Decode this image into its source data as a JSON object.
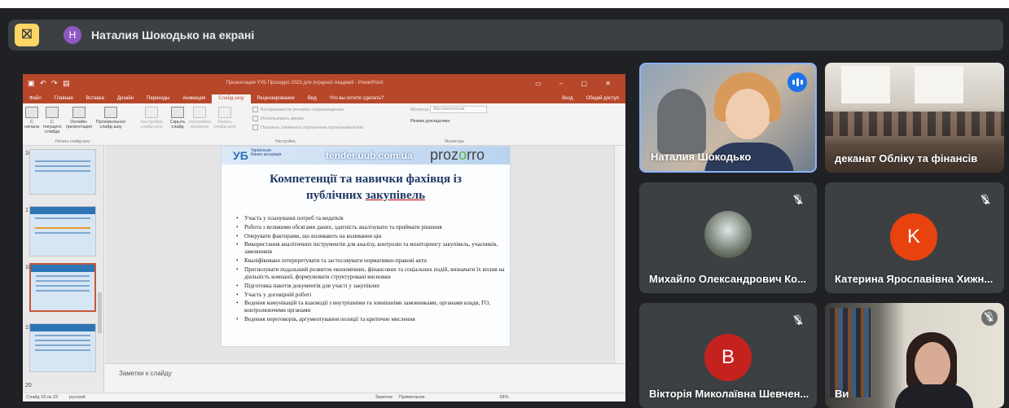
{
  "presentation_bar": {
    "icon": "stop-presenting-icon",
    "avatar_letter": "Н",
    "text": "Наталия Шокодько на екрані"
  },
  "ppt": {
    "title": "Презентация УУБ Прозорро 2023 для Аграрної Академії - PowerPoint",
    "tabs": [
      "Файл",
      "Главная",
      "Вставка",
      "Дизайн",
      "Переходы",
      "Анимация",
      "Слайд-шоу",
      "Рецензирование",
      "Вид",
      "Что вы хотите сделать?"
    ],
    "active_tab": "Слайд-шоу",
    "account": "Вход",
    "share": "Общий доступ",
    "ribbon": {
      "btn1": "С начала",
      "btn2": "С текущего слайда",
      "btn3": "Онлайн-презентация",
      "btn4": "Произвольное слайд-шоу",
      "btn5": "Настройка слайд-шоу",
      "btn6": "Скрыть слайд",
      "btn7": "Настройка времени",
      "btn8": "Запись слайд-шоу",
      "chk1": "Воспроизвести речевое сопровождение",
      "chk2": "Использовать время",
      "chk3": "Показать элементы управления проигрывателем",
      "monitor_label": "Монитор:",
      "monitor_value": "Автоматически",
      "presenter_mode": "Режим докладчика",
      "group1": "Начать слайд-шоу",
      "group2": "Настройка",
      "group3": "Мониторы"
    },
    "thumb_numbers": [
      "16",
      "17",
      "18",
      "19",
      "20"
    ],
    "slide": {
      "logo_text": "Українська бізнес-асоціація",
      "site": "tender.uub.com.ua",
      "prozorro_a": "proz",
      "prozorro_b": "o",
      "prozorro_c": "rro",
      "title_line1": "Компетенції та навички фахівця із",
      "title_line2_a": "публічних ",
      "title_line2_b": "закупівель",
      "bullets": [
        "Участь у плануванні потреб та видатків",
        "Робота з великими обсягами даних, здатність аналізувати та приймати рішення",
        "Оперувати факторами, що впливають на коливання цін",
        "Використання аналітичних інструментів для аналізу, контролю та моніторингу закупівель, учасників, замовників",
        "Кваліфіковано інтерпретувати та застосовувати нормативно-правові акти",
        "Прогнозувати подальший розвиток економічних, фінансових та соціальних подій, визначати їх вплив на діяльність компанії, формулювати структуровані висновки",
        "Підготовка пакетів документів для участі у закупівлях",
        "Участь у договірній роботі",
        "Ведення комунікацій та взаємодії з внутрішніми та зовнішніми замовниками, органами влади, ГО, контролюючими органами",
        "Ведення переговорів, аргументування позиції та критичне мислення"
      ]
    },
    "notes_placeholder": "Заметки к слайду",
    "status": {
      "slide_of": "Слайд 18 из 23",
      "language": "русский",
      "notes": "Заметки",
      "comments": "Примечания",
      "zoom": "68%"
    }
  },
  "participants": [
    {
      "name": "Наталия Шокодько",
      "state": "speaking"
    },
    {
      "name": "деканат Обліку та фінансів",
      "state": "video"
    },
    {
      "name": "Михайло Олександрович Ко...",
      "state": "muted"
    },
    {
      "name": "Катерина Ярославівна Хижн...",
      "state": "muted",
      "avatar_letter": "K",
      "avatar_color": "#e8430f"
    },
    {
      "name": "Вікторія Миколаївна Шевчен...",
      "state": "muted",
      "avatar_letter": "B",
      "avatar_color": "#c5221f"
    },
    {
      "name": "Ви",
      "state": "muted"
    }
  ]
}
